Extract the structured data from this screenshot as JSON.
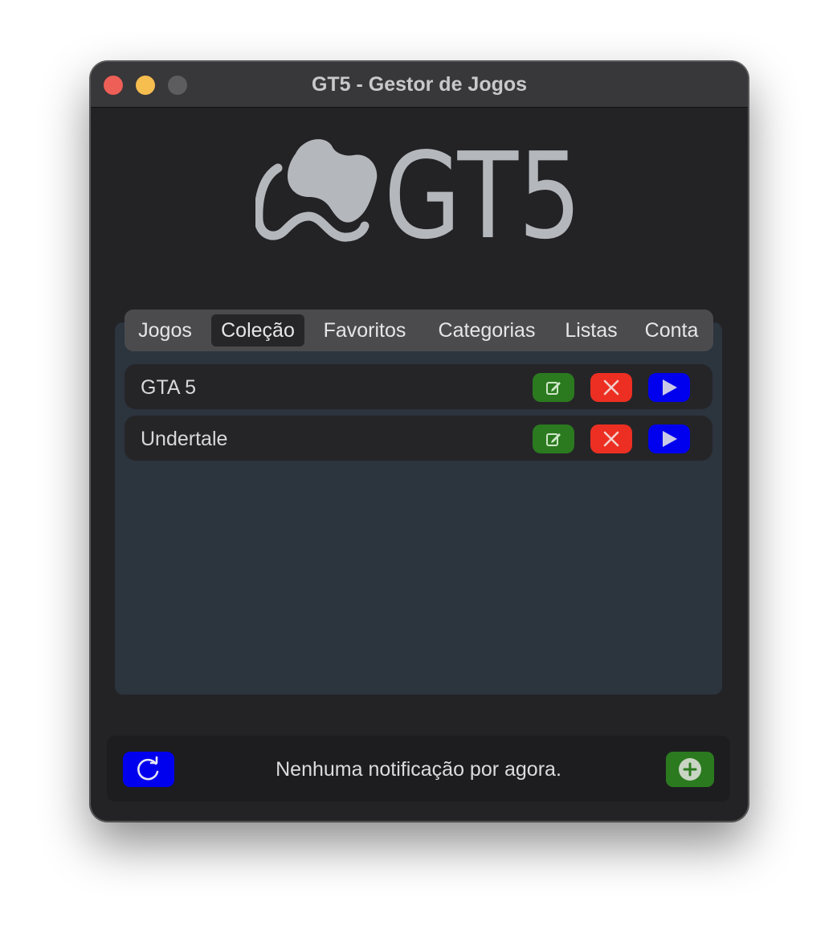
{
  "window": {
    "title": "GT5 - Gestor de Jogos"
  },
  "logo": {
    "text": "GT5",
    "icon": "gamepad-icon",
    "color": "#b4b7bc"
  },
  "tabs": [
    {
      "label": "Jogos",
      "active": false
    },
    {
      "label": "Coleção",
      "active": true
    },
    {
      "label": "Favoritos",
      "active": false
    },
    {
      "label": "Categorias",
      "active": false
    },
    {
      "label": "Listas",
      "active": false
    },
    {
      "label": "Conta",
      "active": false
    }
  ],
  "games": [
    {
      "name": "GTA 5"
    },
    {
      "name": "Undertale"
    }
  ],
  "row_actions": {
    "edit_icon": "edit-icon",
    "delete_icon": "close-icon",
    "play_icon": "play-icon"
  },
  "footer": {
    "notification": "Nenhuma notificação por agora.",
    "refresh_icon": "refresh-icon",
    "add_icon": "add-circle-icon"
  },
  "colors": {
    "edit": "#2b7a1f",
    "delete": "#ec2f22",
    "play": "#0000ee",
    "panel": "#2c343e",
    "window": "#232325"
  }
}
